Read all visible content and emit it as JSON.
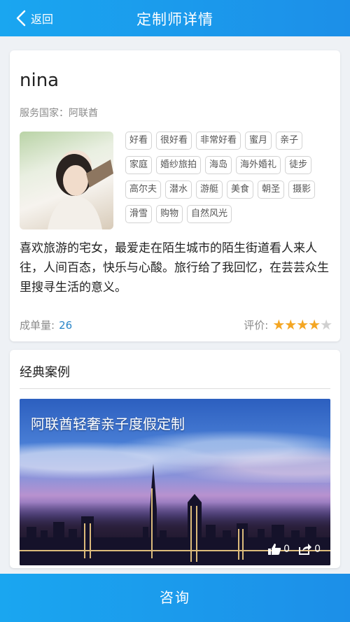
{
  "header": {
    "back_label": "返回",
    "title": "定制师详情"
  },
  "profile": {
    "name": "nina",
    "country": "服务国家：阿联酋",
    "tags": [
      "好看",
      "很好看",
      "非常好看",
      "蜜月",
      "亲子",
      "家庭",
      "婚纱旅拍",
      "海岛",
      "海外婚礼",
      "徒步",
      "高尔夫",
      "潜水",
      "游艇",
      "美食",
      "朝圣",
      "摄影",
      "滑雪",
      "购物",
      "自然风光"
    ],
    "bio": "喜欢旅游的宅女，最爱走在陌生城市的陌生街道看人来人往，人间百态，快乐与心酸。旅行给了我回忆，在芸芸众生里搜寻生活的意义。",
    "orders_label": "成单量:",
    "orders_value": "26",
    "rating_label": "评价:",
    "rating_stars": 4,
    "rating_max": 5,
    "star_color": "#f4a623"
  },
  "cases": {
    "section_title": "经典案例",
    "items": [
      {
        "title": "阿联酋轻奢亲子度假定制",
        "likes": "0",
        "shares": "0"
      }
    ]
  },
  "footer": {
    "consult_label": "咨询"
  },
  "colors": {
    "brand": "#1aa6f0",
    "link": "#2b86c8"
  }
}
